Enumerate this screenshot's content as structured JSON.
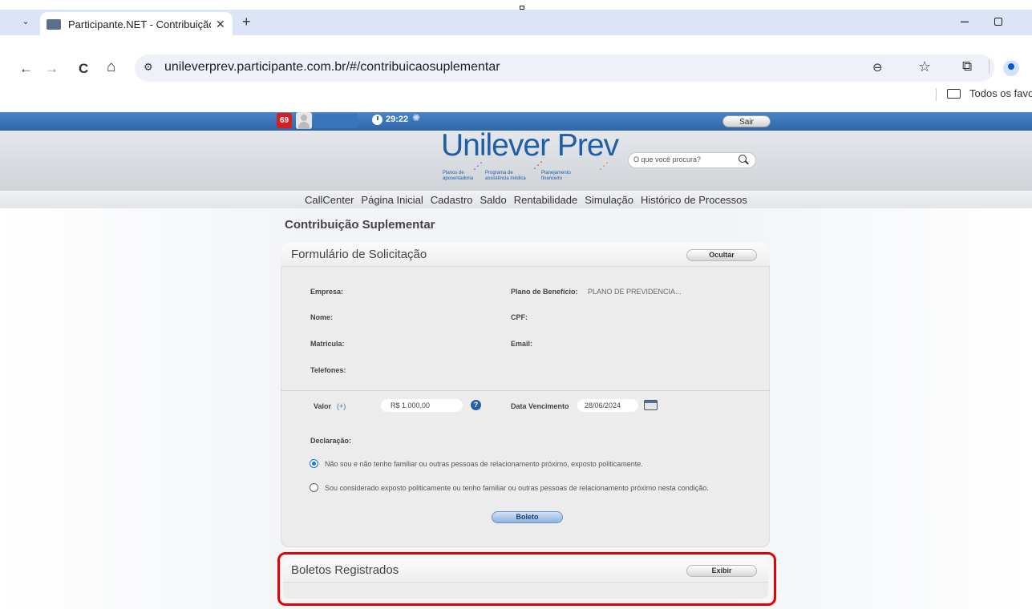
{
  "browser": {
    "tab_title": "Participante.NET - Contribuição",
    "tab_menu_glyph": "⌄",
    "close_glyph": "✕",
    "new_tab_glyph": "+",
    "minimize_glyph": "–",
    "back_glyph": "←",
    "forward_glyph": "→",
    "reload_glyph": "C",
    "home_glyph": "⌂",
    "site_info_glyph": "⚙",
    "url": "unileverprev.participante.com.br/#/contribuicaosuplementar",
    "zoom_glyph": "⊖",
    "star_glyph": "☆",
    "extensions_glyph": "⧉",
    "bookmarks_label": "Todos os favor"
  },
  "topbar": {
    "notification_count": "69",
    "timer": "29:22",
    "spinner_glyph": "✺",
    "logout_label": "Sair"
  },
  "header": {
    "logo": "Unilever Prev",
    "tag_1": "Planos de aposentadoria",
    "tag_2": "Programa de assistência médica",
    "tag_3": "Planejamento financeiro",
    "search_placeholder": "O que você procura?"
  },
  "nav": {
    "items": [
      "CallCenter",
      "Página Inicial",
      "Cadastro",
      "Saldo",
      "Rentabilidade",
      "Simulação",
      "Histórico de Processos"
    ]
  },
  "page": {
    "title": "Contribuição Suplementar"
  },
  "form": {
    "title": "Formulário de Solicitação",
    "hide_label": "Ocultar",
    "empresa_label": "Empresa:",
    "nome_label": "Nome:",
    "matricula_label": "Matricula:",
    "telefones_label": "Telefones:",
    "plano_label": "Plano de Benefício:",
    "plano_value": "PLANO DE PREVIDENCIA...",
    "cpf_label": "CPF:",
    "email_label": "Email:",
    "valor_label": "Valor",
    "valor_suffix": "(+)",
    "valor_value": "R$ 1.000,00",
    "help_glyph": "?",
    "vencimento_label": "Data Vencimento",
    "vencimento_value": "28/06/2024",
    "declaracao_label": "Declaração:",
    "option_1": "Não sou e não tenho familiar ou outras pessoas de relacionamento próximo, exposto politicamente.",
    "option_2": "Sou considerado exposto politicamente ou tenho familiar ou outras pessoas de relacionamento próximo nesta condição.",
    "selected_option": 1,
    "submit_label": "Boleto"
  },
  "boletos": {
    "title": "Boletos Registrados",
    "show_label": "Exibir"
  },
  "colors": {
    "brand_blue": "#1f5fa8",
    "topbar_blue": "#2e66aa",
    "highlight_red": "#e60000"
  }
}
